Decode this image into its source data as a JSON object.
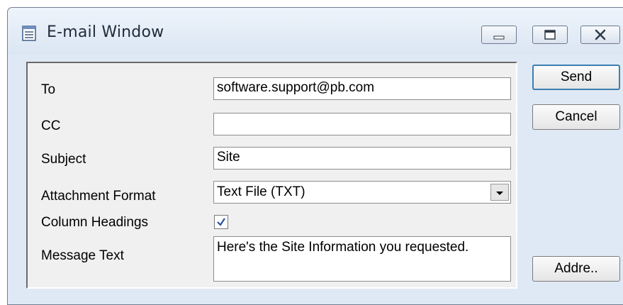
{
  "window": {
    "title": "E-mail Window",
    "icon": "document-window-icon",
    "controls": {
      "minimize": "minimize-icon",
      "maximize": "maximize-icon",
      "close": "close-icon"
    }
  },
  "form": {
    "to": {
      "label": "To",
      "value": "software.support@pb.com"
    },
    "cc": {
      "label": "CC",
      "value": ""
    },
    "subject": {
      "label": "Subject",
      "value": "Site"
    },
    "attachment_format": {
      "label": "Attachment Format",
      "selected": "Text File (TXT)"
    },
    "column_headings": {
      "label": "Column Headings",
      "checked": true
    },
    "message_text": {
      "label": "Message Text",
      "value": "Here's the Site Information you requested."
    }
  },
  "buttons": {
    "send": "Send",
    "cancel": "Cancel",
    "address": "Addre.."
  },
  "colors": {
    "default_button_border": "#3c7fb1",
    "window_frame": "#dfe9f5",
    "panel_background": "#f0f0f0"
  }
}
